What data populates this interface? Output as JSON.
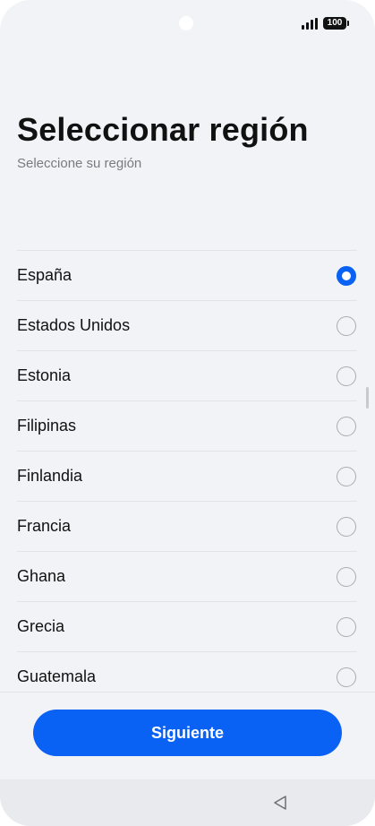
{
  "status_bar": {
    "battery": "100",
    "icons": [
      "front-camera",
      "signal-icon",
      "battery-icon"
    ]
  },
  "header": {
    "title": "Seleccionar región",
    "subtitle": "Seleccione su región"
  },
  "regions": [
    {
      "label": "España",
      "selected": true
    },
    {
      "label": "Estados Unidos",
      "selected": false
    },
    {
      "label": "Estonia",
      "selected": false
    },
    {
      "label": "Filipinas",
      "selected": false
    },
    {
      "label": "Finlandia",
      "selected": false
    },
    {
      "label": "Francia",
      "selected": false
    },
    {
      "label": "Ghana",
      "selected": false
    },
    {
      "label": "Grecia",
      "selected": false
    },
    {
      "label": "Guatemala",
      "selected": false
    }
  ],
  "footer": {
    "next_label": "Siguiente"
  },
  "navigation": {
    "back_icon": "triangle-back-icon"
  },
  "colors": {
    "accent": "#0a62f5",
    "background": "#f2f3f6",
    "text": "#111111",
    "subtext": "#777b82"
  }
}
